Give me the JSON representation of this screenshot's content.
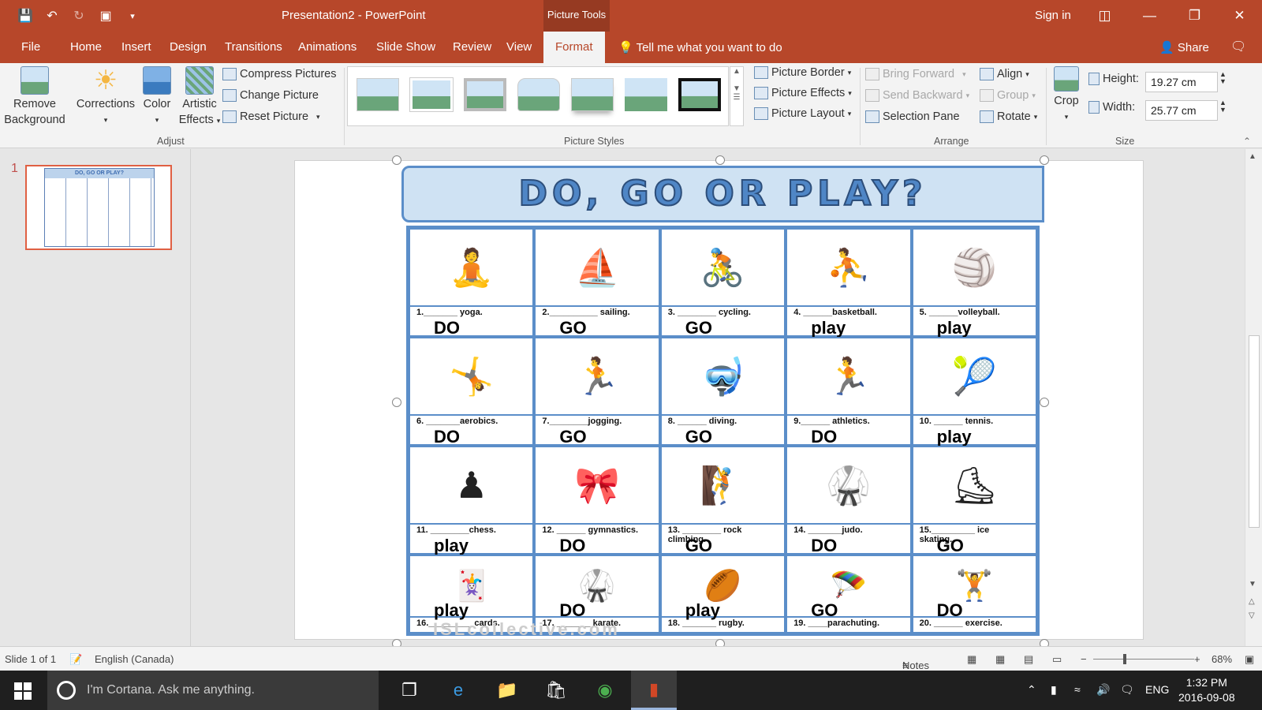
{
  "window": {
    "title": "Presentation2 - PowerPoint",
    "context_tab": "Picture Tools",
    "sign_in": "Sign in"
  },
  "tabs": {
    "file": "File",
    "items": [
      "Home",
      "Insert",
      "Design",
      "Transitions",
      "Animations",
      "Slide Show",
      "Review",
      "View"
    ],
    "active": "Format",
    "tell_me": "Tell me what you want to do",
    "share": "Share"
  },
  "ribbon": {
    "adjust": {
      "label": "Adjust",
      "remove_bg_1": "Remove",
      "remove_bg_2": "Background",
      "corrections": "Corrections",
      "color": "Color",
      "artistic_1": "Artistic",
      "artistic_2": "Effects",
      "compress": "Compress Pictures",
      "change": "Change Picture",
      "reset": "Reset Picture"
    },
    "styles": {
      "label": "Picture Styles",
      "border": "Picture Border",
      "effects": "Picture Effects",
      "layout": "Picture Layout"
    },
    "arrange": {
      "label": "Arrange",
      "bring_forward": "Bring Forward",
      "send_backward": "Send Backward",
      "selection_pane": "Selection Pane",
      "align": "Align",
      "group": "Group",
      "rotate": "Rotate"
    },
    "size": {
      "label": "Size",
      "crop": "Crop",
      "height_label": "Height:",
      "height_value": "19.27 cm",
      "width_label": "Width:",
      "width_value": "25.77 cm"
    }
  },
  "slides_pane": {
    "number": "1",
    "thumb_title": "DO, GO OR PLAY?"
  },
  "worksheet": {
    "title": "DO, GO OR PLAY?",
    "watermark": "ISLcollective.com",
    "cells": [
      {
        "icon": "🧘",
        "q": "1._______ yoga.",
        "a": "DO"
      },
      {
        "icon": "⛵",
        "q": "2.__________ sailing.",
        "a": "GO"
      },
      {
        "icon": "🚴",
        "q": "3. ________ cycling.",
        "a": "GO"
      },
      {
        "icon": "⛹",
        "q": "4. ______basketball.",
        "a": "play"
      },
      {
        "icon": "🏐",
        "q": "5. ______volleyball.",
        "a": "play"
      },
      {
        "icon": "🤸",
        "q": "6. _______aerobics.",
        "a": "DO"
      },
      {
        "icon": "🏃",
        "q": "7.________jogging.",
        "a": "GO"
      },
      {
        "icon": "🤿",
        "q": "8. ______ diving.",
        "a": "GO"
      },
      {
        "icon": "🏃",
        "q": "9.______ athletics.",
        "a": "DO"
      },
      {
        "icon": "🎾",
        "q": "10. ______ tennis.",
        "a": "play"
      },
      {
        "icon": "♟",
        "q": "11. ________chess.",
        "a": "play"
      },
      {
        "icon": "🎀",
        "q": "12. ______ gymnastics.",
        "a": "DO"
      },
      {
        "icon": "🧗",
        "q": "13. ________ rock\nclimbing.",
        "a": "GO"
      },
      {
        "icon": "🥋",
        "q": "14. _______judo.",
        "a": "DO"
      },
      {
        "icon": "⛸",
        "q": "15._________ ice\nskating.",
        "a": "GO"
      },
      {
        "icon": "🃏",
        "q": "16._________ cards.",
        "a": "play"
      },
      {
        "icon": "🥋",
        "q": "17. _______ karate.",
        "a": "DO"
      },
      {
        "icon": "🏉",
        "q": "18. _______ rugby.",
        "a": "play"
      },
      {
        "icon": "🪂",
        "q": "19. ____parachuting.",
        "a": "GO"
      },
      {
        "icon": "🏋",
        "q": "20. ______ exercise.",
        "a": "DO"
      }
    ]
  },
  "status": {
    "slide": "Slide 1 of 1",
    "language": "English (Canada)",
    "notes": "Notes",
    "zoom": "68%"
  },
  "taskbar": {
    "cortana": "I'm Cortana. Ask me anything.",
    "lang": "ENG",
    "time": "1:32 PM",
    "date": "2016-09-08"
  },
  "colors": {
    "accent": "#b7472a",
    "ribbon_bg": "#f3f3f3",
    "worksheet_blue": "#5b8ec9"
  }
}
